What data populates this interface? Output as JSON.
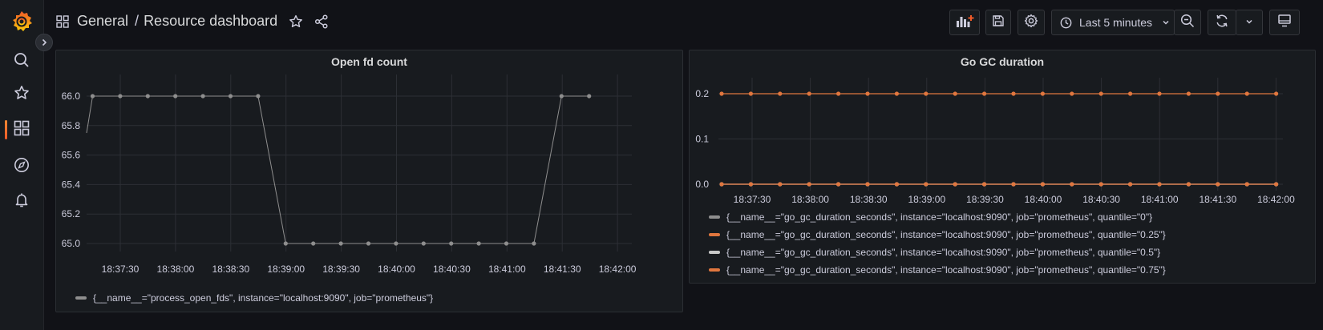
{
  "colors": {
    "accent": "#f05a28",
    "series_gray": "#8e8e8e",
    "series_orange": "#e0763e",
    "series_lightgray": "#c8c8c8",
    "grid": "#2c2f35"
  },
  "sidebar": {
    "logo_icon": "grafana-logo",
    "items": [
      {
        "icon": "search-icon",
        "active": false
      },
      {
        "icon": "star-icon",
        "active": false
      },
      {
        "icon": "dashboards-icon",
        "active": true
      },
      {
        "icon": "explore-compass-icon",
        "active": false
      },
      {
        "icon": "alerting-bell-icon",
        "active": false
      }
    ]
  },
  "header": {
    "folder": "General",
    "separator": "/",
    "title": "Resource dashboard",
    "time_range": "Last 5 minutes"
  },
  "chart_data": [
    {
      "type": "line",
      "title": "Open fd count",
      "x": [
        "18:37:10",
        "18:37:20",
        "18:37:35",
        "18:37:50",
        "18:38:05",
        "18:38:20",
        "18:38:35",
        "18:38:50",
        "18:39:05",
        "18:39:20",
        "18:39:35",
        "18:39:50",
        "18:40:05",
        "18:40:20",
        "18:40:35",
        "18:40:50",
        "18:41:05",
        "18:41:20",
        "18:41:35",
        "18:41:50",
        "18:42:05"
      ],
      "x_ticks": [
        "18:37:30",
        "18:38:00",
        "18:38:30",
        "18:39:00",
        "18:39:30",
        "18:40:00",
        "18:40:30",
        "18:41:00",
        "18:41:30",
        "18:42:00"
      ],
      "y_ticks": [
        "66.0",
        "65.8",
        "65.6",
        "65.4",
        "65.2",
        "65.0"
      ],
      "ylim": [
        64.95,
        66.1
      ],
      "grid": true,
      "legend_position": "bottom-left",
      "series": [
        {
          "name": "{__name__=\"process_open_fds\", instance=\"localhost:9090\", job=\"prometheus\"}",
          "color": "#8e8e8e",
          "points": [
            {
              "t": 0,
              "v": 65.75,
              "marker": false
            },
            {
              "t": 1,
              "v": 66.0
            },
            {
              "t": 2,
              "v": 66.0
            },
            {
              "t": 3,
              "v": 66.0
            },
            {
              "t": 4,
              "v": 66.0
            },
            {
              "t": 5,
              "v": 66.0
            },
            {
              "t": 6,
              "v": 66.0
            },
            {
              "t": 7,
              "v": 66.0
            },
            {
              "t": 8,
              "v": 65.0
            },
            {
              "t": 9,
              "v": 65.0
            },
            {
              "t": 10,
              "v": 65.0
            },
            {
              "t": 11,
              "v": 65.0
            },
            {
              "t": 12,
              "v": 65.0
            },
            {
              "t": 13,
              "v": 65.0
            },
            {
              "t": 14,
              "v": 65.0
            },
            {
              "t": 15,
              "v": 65.0
            },
            {
              "t": 16,
              "v": 65.0
            },
            {
              "t": 17,
              "v": 65.0
            },
            {
              "t": 18,
              "v": 66.0
            },
            {
              "t": 19,
              "v": 66.0
            }
          ]
        }
      ]
    },
    {
      "type": "line",
      "title": "Go GC duration",
      "x_ticks": [
        "18:37:30",
        "18:38:00",
        "18:38:30",
        "18:39:00",
        "18:39:30",
        "18:40:00",
        "18:40:30",
        "18:41:00",
        "18:41:30",
        "18:42:00"
      ],
      "y_ticks": [
        "0.2",
        "0.1",
        "0.0"
      ],
      "ylim": [
        0.0,
        0.2
      ],
      "point_count": 20,
      "grid": true,
      "legend_position": "bottom-left",
      "series": [
        {
          "name": "{__name__=\"go_gc_duration_seconds\", instance=\"localhost:9090\", job=\"prometheus\", quantile=\"0\"}",
          "color": "#8e8e8e",
          "value": 0.0
        },
        {
          "name": "{__name__=\"go_gc_duration_seconds\", instance=\"localhost:9090\", job=\"prometheus\", quantile=\"0.25\"}",
          "color": "#e0763e",
          "value": 0.0
        },
        {
          "name": "{__name__=\"go_gc_duration_seconds\", instance=\"localhost:9090\", job=\"prometheus\", quantile=\"0.5\"}",
          "color": "#c8c8c8",
          "value": 0.0
        },
        {
          "name": "{__name__=\"go_gc_duration_seconds\", instance=\"localhost:9090\", job=\"prometheus\", quantile=\"0.75\"}",
          "color": "#e0763e",
          "value": 0.2
        }
      ]
    }
  ]
}
